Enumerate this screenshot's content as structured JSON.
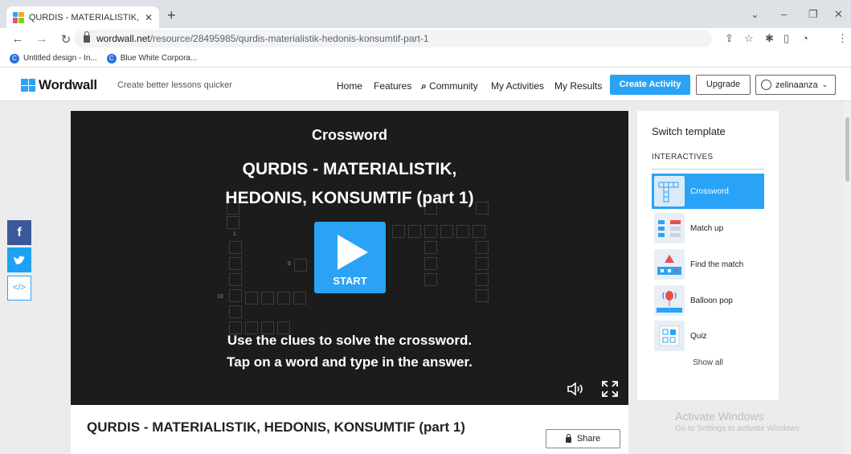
{
  "browser": {
    "tab_title": "QURDIS - MATERIALISTIK, HEDO",
    "url_host": "wordwall.net",
    "url_path": "/resource/28495985/qurdis-materialistik-hedonis-konsumtif-part-1",
    "bookmarks": [
      {
        "label": "Untitled design - In..."
      },
      {
        "label": "Blue White Corpora..."
      }
    ]
  },
  "header": {
    "logo": "Wordwall",
    "tagline": "Create better lessons quicker",
    "nav": {
      "home": "Home",
      "features": "Features",
      "community": "Community",
      "activities": "My Activities",
      "results": "My Results"
    },
    "create_label": "Create Activity",
    "upgrade_label": "Upgrade",
    "username": "zelinaanza"
  },
  "game": {
    "template_name": "Crossword",
    "title_line1": "QURDIS - MATERIALISTIK,",
    "title_line2": "HEDONIS, KONSUMTIF (part 1)",
    "start_label": "START",
    "instruction_line1": "Use the clues to solve the crossword.",
    "instruction_line2": "Tap on a word and type in the answer.",
    "grid_numbers": [
      "1",
      "6",
      "10"
    ]
  },
  "panel": {
    "title": "Switch template",
    "section": "INTERACTIVES",
    "templates": [
      {
        "label": "Crossword",
        "selected": true
      },
      {
        "label": "Match up",
        "selected": false
      },
      {
        "label": "Find the match",
        "selected": false
      },
      {
        "label": "Balloon pop",
        "selected": false
      },
      {
        "label": "Quiz",
        "selected": false
      }
    ],
    "show_all": "Show all"
  },
  "page": {
    "title": "QURDIS - MATERIALISTIK, HEDONIS, KONSUMTIF (part 1)",
    "share_label": "Share"
  },
  "watermark": {
    "line1": "Activate Windows",
    "line2": "Go to Settings to activate Windows."
  },
  "colors": {
    "accent": "#2aa3f6",
    "game_bg": "#1c1c1c",
    "facebook": "#3b5998",
    "twitter": "#1da1f2"
  }
}
